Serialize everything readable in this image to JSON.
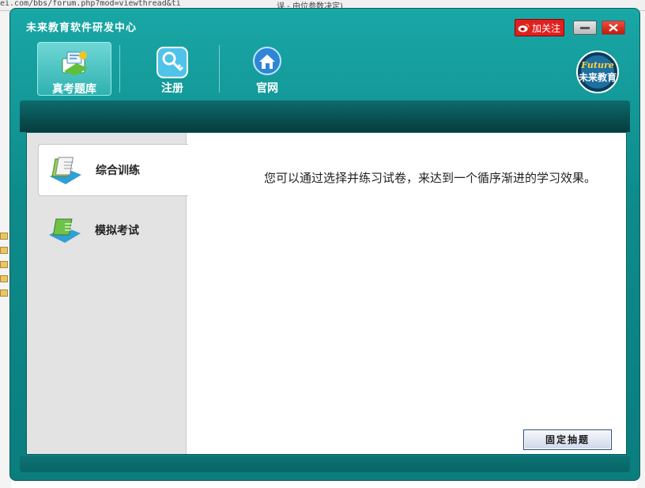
{
  "background": {
    "url_fragment": "ei.com/bbs/forum.php?mod=viewthread&ti",
    "tab_fragment": "误 - 由位参数决定)"
  },
  "window": {
    "title": "未来教育软件研发中心",
    "weibo_follow": "加关注",
    "icons": {
      "minimize": "minimize-icon",
      "close": "close-icon",
      "weibo": "weibo-icon"
    }
  },
  "nav": {
    "items": [
      {
        "label": "真考题库",
        "icon": "exam-bank-icon",
        "active": true
      },
      {
        "label": "注册",
        "icon": "key-icon",
        "active": false
      },
      {
        "label": "官网",
        "icon": "home-icon",
        "active": false
      }
    ],
    "logo_text_top": "Future",
    "logo_text_bottom": "未来教育"
  },
  "sidebar": {
    "items": [
      {
        "label": "综合训练",
        "icon": "books-icon",
        "active": true
      },
      {
        "label": "模拟考试",
        "icon": "exam-book-icon",
        "active": false
      }
    ]
  },
  "main": {
    "description": "您可以通过选择并练习试卷，来达到一个循序渐进的学习效果。",
    "fixed_draw_button": "固定抽题"
  },
  "colors": {
    "frame": "#0e8b8b",
    "dark_bar": "#063c3d",
    "close": "#d02015",
    "weibo": "#e02020"
  }
}
